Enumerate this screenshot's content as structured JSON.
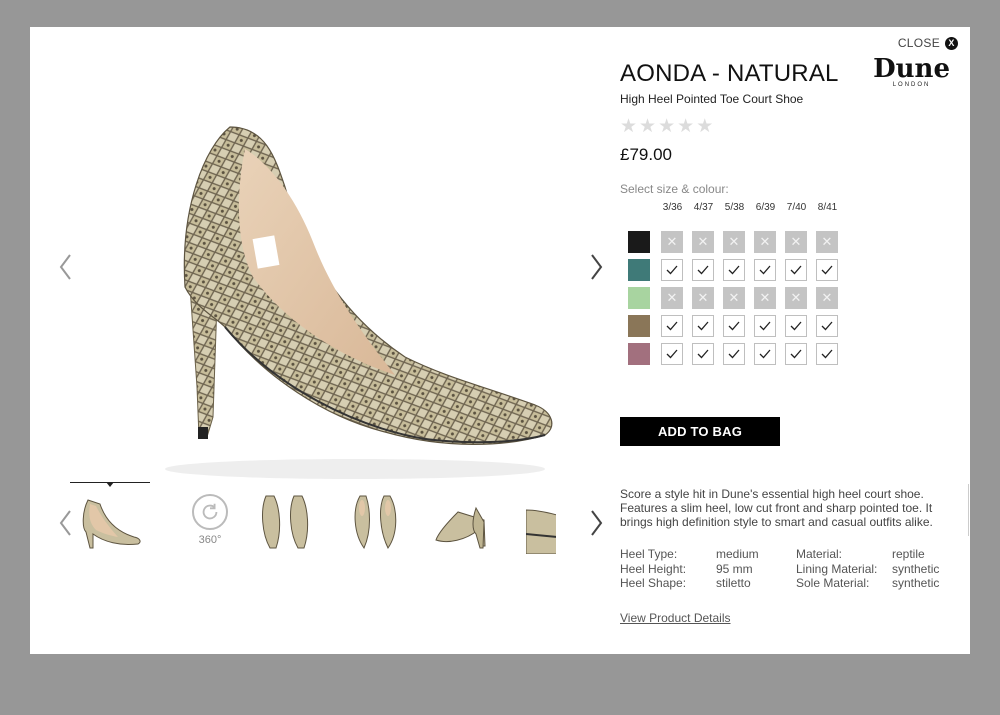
{
  "modal": {
    "close_label": "CLOSE",
    "close_icon_glyph": "X"
  },
  "product": {
    "title": "AONDA - NATURAL",
    "subtitle": "High Heel Pointed Toe Court Shoe",
    "brand_name": "Dune",
    "brand_sub": "LONDON",
    "rating_stars": 0,
    "rating_max": 5,
    "price": "£79.00",
    "select_label": "Select size & colour:",
    "add_to_bag": "ADD TO BAG",
    "description": "Score a style hit in Dune's essential high heel court shoe. Features a slim heel, low cut front and sharp pointed toe. It brings high definition style to smart and casual outfits alike.",
    "view_details": "View Product Details"
  },
  "sizes": [
    "3/36",
    "4/37",
    "5/38",
    "6/39",
    "7/40",
    "8/41"
  ],
  "colours": [
    {
      "name": "black",
      "swatch": "#1a1a1a",
      "available": [
        false,
        false,
        false,
        false,
        false,
        false
      ]
    },
    {
      "name": "teal",
      "swatch": "#3f7a78",
      "available": [
        true,
        true,
        true,
        true,
        true,
        true
      ]
    },
    {
      "name": "mint",
      "swatch": "#a8d4a0",
      "available": [
        false,
        false,
        false,
        false,
        false,
        false
      ]
    },
    {
      "name": "natural",
      "swatch": "#8a7658",
      "available": [
        true,
        true,
        true,
        true,
        true,
        true
      ]
    },
    {
      "name": "pink",
      "swatch": "#a2707e",
      "available": [
        true,
        true,
        true,
        true,
        true,
        true
      ]
    }
  ],
  "specs": [
    {
      "k1": "Heel Type:",
      "v1": "medium",
      "k2": "Material:",
      "v2": "reptile"
    },
    {
      "k1": "Heel Height:",
      "v1": "95 mm",
      "k2": "Lining Material:",
      "v2": "synthetic"
    },
    {
      "k1": "Heel Shape:",
      "v1": "stiletto",
      "k2": "Sole Material:",
      "v2": "synthetic"
    }
  ],
  "gallery": {
    "spin_label": "360°"
  },
  "colors": {
    "background": "#979797",
    "modal": "#ffffff",
    "button": "#000000",
    "unavailable": "#c4c4c4"
  }
}
